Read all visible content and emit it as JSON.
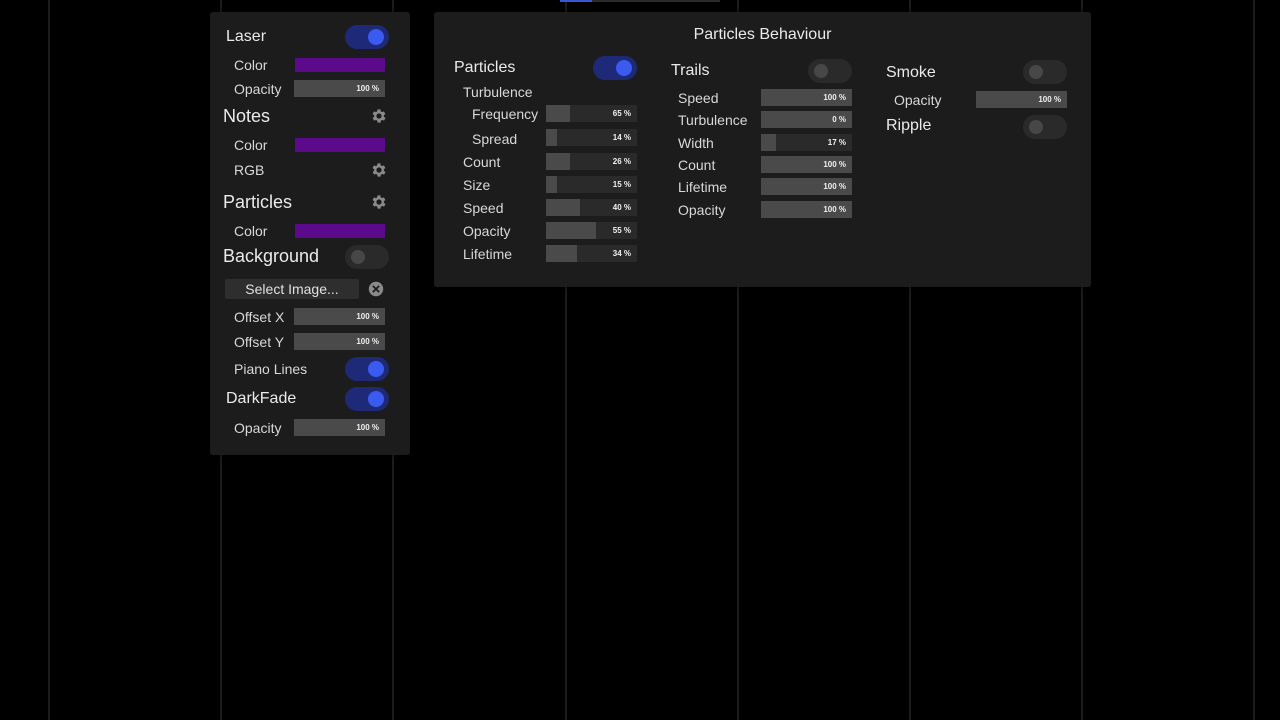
{
  "colors": {
    "purple": "#5c0a8c",
    "toggle_on_track": "#1e2a78",
    "toggle_on_knob": "#3b5af0"
  },
  "left": {
    "laser": {
      "title": "Laser",
      "color_label": "Color",
      "opacity_label": "Opacity",
      "opacity_value": "100 %",
      "opacity": 1.0,
      "enabled": true
    },
    "notes": {
      "title": "Notes",
      "color_label": "Color",
      "rgb_label": "RGB",
      "settings_icon": "gear-icon"
    },
    "particles": {
      "title": "Particles",
      "color_label": "Color",
      "settings_icon": "gear-icon"
    },
    "background": {
      "title": "Background",
      "enabled": false,
      "select_image": "Select Image...",
      "clear_icon": "close-circle-icon",
      "offset_x_label": "Offset X",
      "offset_x_value": "100 %",
      "offset_x": 1.0,
      "offset_y_label": "Offset Y",
      "offset_y_value": "100 %",
      "offset_y": 1.0,
      "piano_lines_label": "Piano Lines",
      "piano_lines": true
    },
    "darkfade": {
      "title": "DarkFade",
      "enabled": true,
      "opacity_label": "Opacity",
      "opacity_value": "100 %",
      "opacity": 1.0
    }
  },
  "behaviour": {
    "title": "Particles Behaviour",
    "particles": {
      "title": "Particles",
      "enabled": true,
      "turbulence_label": "Turbulence",
      "frequency_label": "Frequency",
      "frequency_value": "65 %",
      "frequency": 0.26,
      "spread_label": "Spread",
      "spread_value": "14 %",
      "spread": 0.12,
      "count_label": "Count",
      "count_value": "26 %",
      "count": 0.26,
      "size_label": "Size",
      "size_value": "15 %",
      "size": 0.12,
      "speed_label": "Speed",
      "speed_value": "40 %",
      "speed": 0.37,
      "opacity_label": "Opacity",
      "opacity_value": "55 %",
      "opacity": 0.55,
      "lifetime_label": "Lifetime",
      "lifetime_value": "34 %",
      "lifetime": 0.34
    },
    "trails": {
      "title": "Trails",
      "enabled": false,
      "speed_label": "Speed",
      "speed_value": "100 %",
      "speed": 1.0,
      "turbulence_label": "Turbulence",
      "turbulence_value": "0 %",
      "turbulence": 1.0,
      "width_label": "Width",
      "width_value": "17 %",
      "width": 0.17,
      "count_label": "Count",
      "count_value": "100 %",
      "count": 1.0,
      "lifetime_label": "Lifetime",
      "lifetime_value": "100 %",
      "lifetime": 1.0,
      "opacity_label": "Opacity",
      "opacity_value": "100 %",
      "opacity": 1.0
    },
    "smoke": {
      "title": "Smoke",
      "enabled": false,
      "opacity_label": "Opacity",
      "opacity_value": "100 %",
      "opacity": 1.0
    },
    "ripple": {
      "title": "Ripple",
      "enabled": false
    }
  }
}
